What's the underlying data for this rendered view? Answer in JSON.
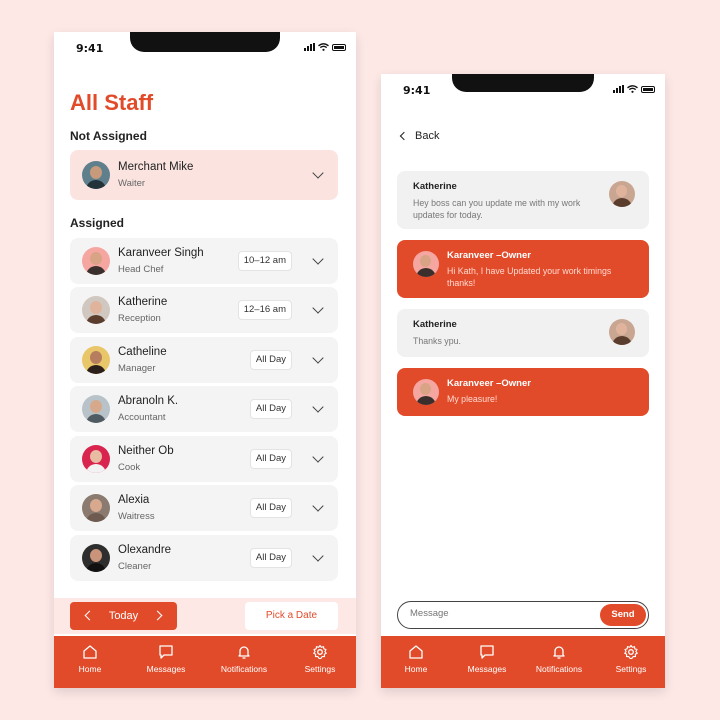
{
  "colors": {
    "accent": "#e24b2a",
    "background": "#fde8e6",
    "card": "#f4f4f4",
    "unassigned_card": "#fbe4e0"
  },
  "staff_screen": {
    "status_time": "9:41",
    "title": "All Staff",
    "not_assigned_label": "Not Assigned",
    "assigned_label": "Assigned",
    "not_assigned": [
      {
        "name": "Merchant Mike",
        "role": "Waiter"
      }
    ],
    "assigned": [
      {
        "name": "Karanveer Singh",
        "role": "Head Chef",
        "time": "10–12 am"
      },
      {
        "name": "Katherine",
        "role": "Reception",
        "time": "12–16 am"
      },
      {
        "name": "Catheline",
        "role": "Manager",
        "time": "All Day"
      },
      {
        "name": "Abranoln K.",
        "role": "Accountant",
        "time": "All Day"
      },
      {
        "name": "Neither Ob",
        "role": "Cook",
        "time": "All Day"
      },
      {
        "name": "Alexia",
        "role": "Waitress",
        "time": "All Day"
      },
      {
        "name": "Olexandre",
        "role": "Cleaner",
        "time": "All Day"
      }
    ],
    "today_label": "Today",
    "pick_date_label": "Pick a Date",
    "nav": [
      {
        "label": "Home",
        "icon": "home-icon"
      },
      {
        "label": "Messages",
        "icon": "message-icon"
      },
      {
        "label": "Notifications",
        "icon": "bell-icon"
      },
      {
        "label": "Settings",
        "icon": "gear-icon"
      }
    ]
  },
  "chat_screen": {
    "status_time": "9:41",
    "back_label": "Back",
    "messages": [
      {
        "sender": "Katherine",
        "text": "Hey boss can you update me with my work updates for today.",
        "direction": "in"
      },
      {
        "sender": "Karanveer –Owner",
        "text": "Hi Kath, I have Updated your work timings thanks!",
        "direction": "out"
      },
      {
        "sender": "Katherine",
        "text": "Thanks ypu.",
        "direction": "in"
      },
      {
        "sender": "Karanveer –Owner",
        "text": "My pleasure!",
        "direction": "out"
      }
    ],
    "input_placeholder": "Message",
    "send_label": "Send",
    "nav": [
      {
        "label": "Home",
        "icon": "home-icon"
      },
      {
        "label": "Messages",
        "icon": "message-icon"
      },
      {
        "label": "Notifications",
        "icon": "bell-icon"
      },
      {
        "label": "Settings",
        "icon": "gear-icon"
      }
    ]
  }
}
